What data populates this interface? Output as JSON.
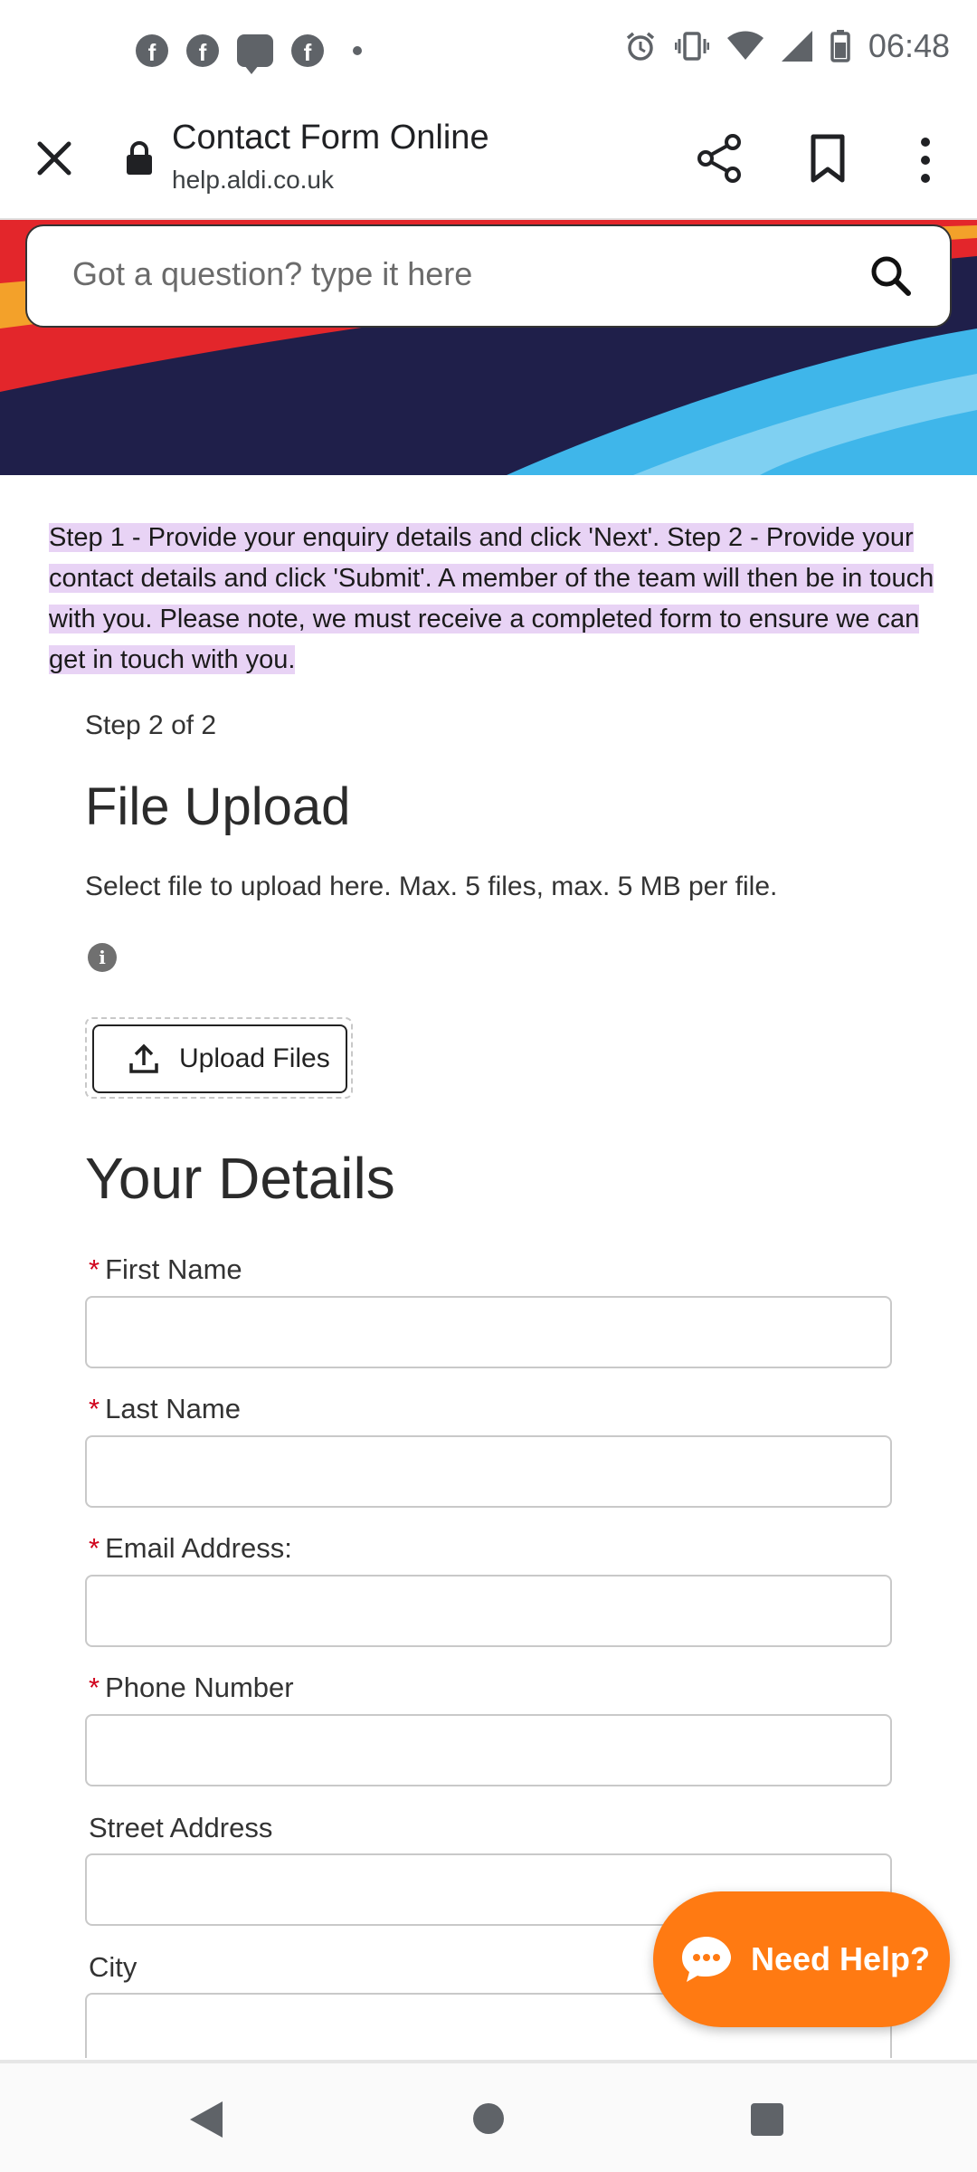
{
  "status_bar": {
    "time": "06:48",
    "left_icons": [
      "facebook-icon",
      "facebook-icon",
      "messenger-icon",
      "facebook-icon",
      "notification-dot-icon"
    ],
    "right_icons": [
      "alarm-icon",
      "vibrate-icon",
      "wifi-icon",
      "signal-icon",
      "battery-icon"
    ]
  },
  "browser": {
    "title": "Contact Form Online",
    "url": "help.aldi.co.uk"
  },
  "search": {
    "placeholder": "Got a question? type it here"
  },
  "intro_text": "Step 1 - Provide your enquiry details and click 'Next'. Step 2 - Provide your contact details and click 'Submit'. A member of the team will then be in touch with you. Please note, we must receive a completed form to ensure we can get in touch with you.",
  "step_indicator": "Step 2 of 2",
  "file_upload": {
    "heading": "File Upload",
    "description": "Select file to upload here. Max. 5 files, max. 5 MB per file.",
    "info_glyph": "i",
    "button_label": "Upload Files"
  },
  "your_details": {
    "heading": "Your Details",
    "required_marker": "*",
    "fields": [
      {
        "label": "First Name",
        "required": true,
        "value": ""
      },
      {
        "label": "Last Name",
        "required": true,
        "value": ""
      },
      {
        "label": "Email Address:",
        "required": true,
        "value": ""
      },
      {
        "label": "Phone Number",
        "required": true,
        "value": ""
      },
      {
        "label": "Street Address",
        "required": false,
        "value": ""
      },
      {
        "label": "City",
        "required": false,
        "value": ""
      }
    ]
  },
  "need_help": {
    "label": "Need Help?"
  },
  "colors": {
    "help_button": "#ff7a12",
    "highlight": "#e8d3f5",
    "required": "#d0021b",
    "hero_red": "#e3262b",
    "hero_navy": "#1f1f4a",
    "hero_blue": "#3fb6ea"
  }
}
